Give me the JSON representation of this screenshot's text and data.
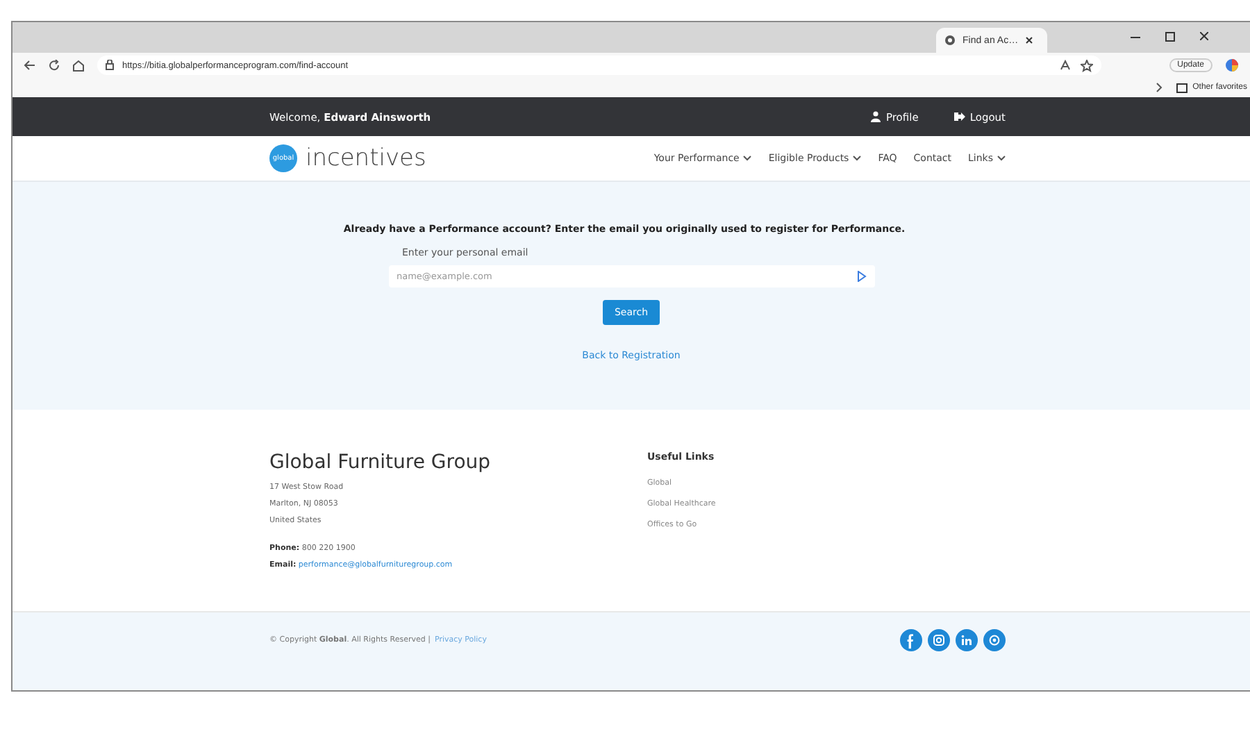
{
  "browser": {
    "tab_title": "Find an Ac…",
    "url": "https://bitia.globalperformanceprogram.com/find-account",
    "update_label": "Update",
    "favorites_label": "Other favorites"
  },
  "topbar": {
    "welcome": "Welcome, **Edward Ainsworth**",
    "links": [
      {
        "label": "Profile",
        "kind": "person"
      },
      {
        "label": "Logout",
        "kind": "exit"
      }
    ]
  },
  "header": {
    "logo_badge": "global",
    "logo_text": "incentives",
    "nav": [
      {
        "label": "Your Performance",
        "has_menu": true
      },
      {
        "label": "Eligible Products",
        "has_menu": true
      },
      {
        "label": "FAQ",
        "has_menu": false
      },
      {
        "label": "Contact",
        "has_menu": false
      },
      {
        "label": "Links",
        "has_menu": true
      }
    ]
  },
  "find_account": {
    "prompt": "Already have a Performance account? Enter the email you originally used to register for Performance.",
    "email_label": "Enter your personal email",
    "email_placeholder": "name@example.com",
    "button": "Search",
    "back_link": "Back to Registration"
  },
  "footer": {
    "company": "Global Furniture Group",
    "address_lines": [
      "17 West Stow Road",
      "Marlton, NJ 08053",
      "United States"
    ],
    "phone_label": "Phone:",
    "phone": "800 220 1900",
    "email_label": "Email:",
    "email": "performance@globalfurnituregroup.com",
    "links_title": "Useful Links",
    "links": [
      "Global",
      "Global Healthcare",
      "Offices to Go"
    ]
  },
  "bottom": {
    "copyright": "© Copyright **Global**. All Rights Reserved |",
    "privacy_link": "Privacy Policy",
    "social": [
      {
        "kind": "facebook"
      },
      {
        "kind": "instagram"
      },
      {
        "kind": "linkedin"
      },
      {
        "kind": "other"
      }
    ]
  }
}
